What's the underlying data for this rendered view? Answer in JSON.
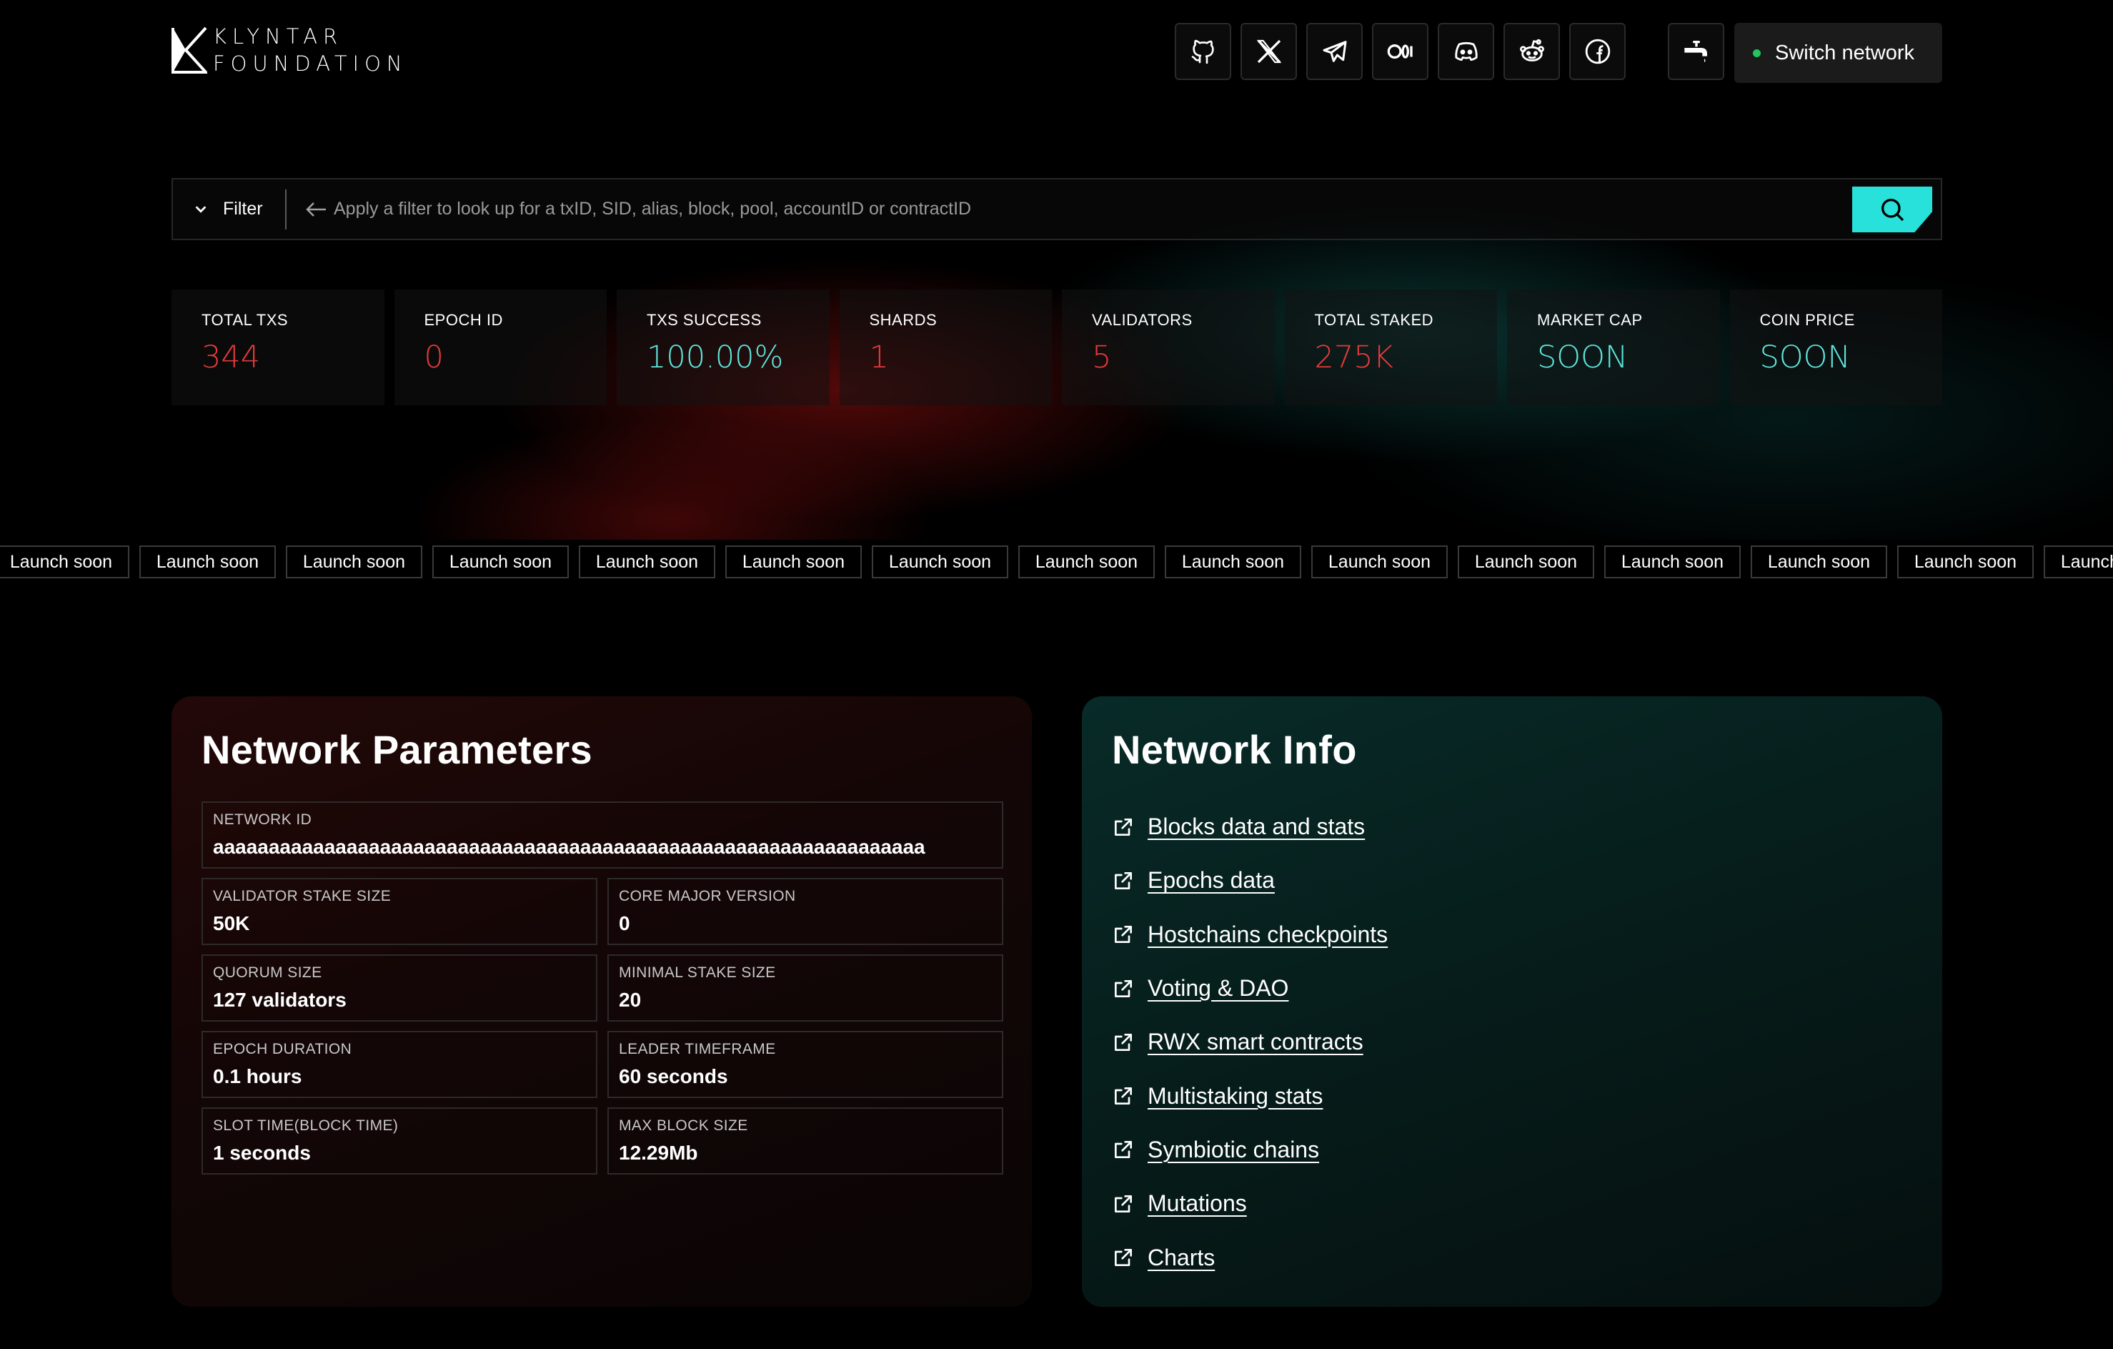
{
  "brand": {
    "line1": "KLYNTAR",
    "line2": "FOUNDATION"
  },
  "header": {
    "social_icons": [
      "github-icon",
      "x-icon",
      "telegram-icon",
      "medium-icon",
      "discord-icon",
      "reddit-icon",
      "facebook-icon"
    ],
    "faucet_icon": "faucet-icon",
    "switch_network_label": "Switch network",
    "status_color": "#22c55e"
  },
  "search": {
    "filter_label": "Filter",
    "placeholder": "Apply a filter to look up for a txID, SID, alias, block, pool, accountID or contractID",
    "button_color": "#27e1da"
  },
  "stats": [
    {
      "label": "TOTAL TXS",
      "value": "344",
      "tone": "red"
    },
    {
      "label": "EPOCH ID",
      "value": "0",
      "tone": "red"
    },
    {
      "label": "TXS SUCCESS",
      "value": "100.00%",
      "tone": "cyan"
    },
    {
      "label": "SHARDS",
      "value": "1",
      "tone": "red"
    },
    {
      "label": "VALIDATORS",
      "value": "5",
      "tone": "red"
    },
    {
      "label": "TOTAL STAKED",
      "value": "275K",
      "tone": "red"
    },
    {
      "label": "MARKET CAP",
      "value": "SOON",
      "tone": "cyan"
    },
    {
      "label": "COIN PRICE",
      "value": "SOON",
      "tone": "cyan"
    }
  ],
  "ticker": {
    "item_label": "Launch soon",
    "count": 15
  },
  "network_parameters": {
    "title": "Network Parameters",
    "network_id": {
      "label": "NETWORK ID",
      "value": "aaaaaaaaaaaaaaaaaaaaaaaaaaaaaaaaaaaaaaaaaaaaaaaaaaaaaaaaaaaaaaaa"
    },
    "params": [
      {
        "label": "VALIDATOR STAKE SIZE",
        "value": "50K"
      },
      {
        "label": "CORE MAJOR VERSION",
        "value": "0"
      },
      {
        "label": "QUORUM SIZE",
        "value": "127 validators"
      },
      {
        "label": "MINIMAL STAKE SIZE",
        "value": "20"
      },
      {
        "label": "EPOCH DURATION",
        "value": "0.1 hours"
      },
      {
        "label": "LEADER TIMEFRAME",
        "value": "60 seconds"
      },
      {
        "label": "SLOT TIME(BLOCK TIME)",
        "value": "1 seconds"
      },
      {
        "label": "MAX BLOCK SIZE",
        "value": "12.29Mb"
      }
    ]
  },
  "network_info": {
    "title": "Network Info",
    "links": [
      "Blocks data and stats",
      "Epochs data",
      "Hostchains checkpoints",
      "Voting & DAO",
      "RWX smart contracts",
      "Multistaking stats",
      "Symbiotic chains",
      "Mutations",
      "Charts"
    ],
    "link_icon": "external-link-icon"
  },
  "colors": {
    "accent_red": "#e43a3a",
    "accent_cyan": "#5ee6dc"
  }
}
